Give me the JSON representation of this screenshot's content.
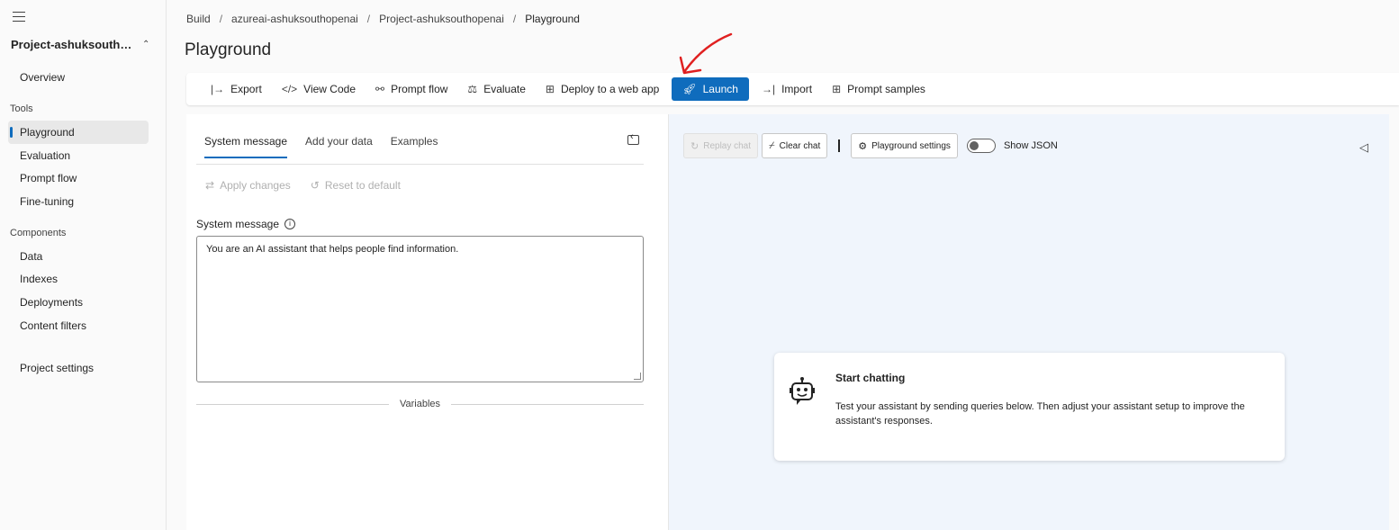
{
  "sidebar": {
    "project_name": "Project-ashuksouthop...",
    "overview": "Overview",
    "tools_heading": "Tools",
    "tools": [
      "Playground",
      "Evaluation",
      "Prompt flow",
      "Fine-tuning"
    ],
    "components_heading": "Components",
    "components": [
      "Data",
      "Indexes",
      "Deployments",
      "Content filters"
    ],
    "project_settings": "Project settings"
  },
  "breadcrumb": [
    "Build",
    "azureai-ashuksouthopenai",
    "Project-ashuksouthopenai",
    "Playground"
  ],
  "page_title": "Playground",
  "toolbar": {
    "export": "Export",
    "view_code": "View Code",
    "prompt_flow": "Prompt flow",
    "evaluate": "Evaluate",
    "deploy": "Deploy to a web app",
    "launch": "Launch",
    "import": "Import",
    "prompt_samples": "Prompt samples"
  },
  "setup": {
    "tabs": [
      "System message",
      "Add your data",
      "Examples"
    ],
    "apply_changes": "Apply changes",
    "reset_default": "Reset to default",
    "system_message_label": "System message",
    "system_message_value": "You are an AI assistant that helps people find information.",
    "variables_label": "Variables"
  },
  "chat": {
    "replay": "Replay chat",
    "clear": "Clear chat",
    "settings": "Playground settings",
    "show_json": "Show JSON",
    "show_json_on": false,
    "card_title": "Start chatting",
    "card_text": "Test your assistant by sending queries below. Then adjust your assistant setup to improve the assistant's responses."
  },
  "colors": {
    "accent": "#0f6cbd",
    "chat_background": "#f0f5fc",
    "annotation": "#e02020"
  }
}
